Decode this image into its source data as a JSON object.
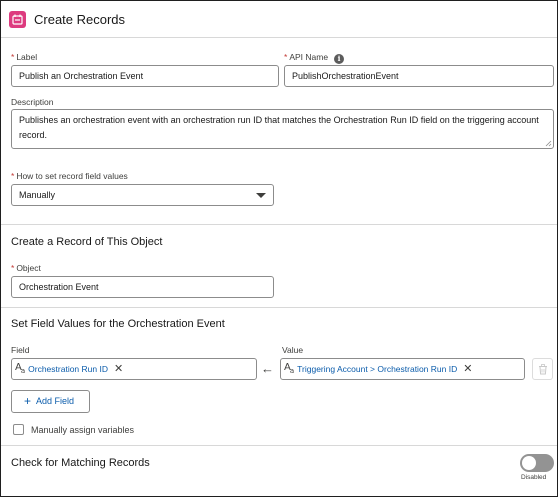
{
  "header": {
    "title": "Create Records",
    "icon": "create-records-icon",
    "icon_color": "#dd3b7f"
  },
  "label_field": {
    "label": "Label",
    "value": "Publish an Orchestration Event"
  },
  "api_name_field": {
    "label": "API Name",
    "value": "PublishOrchestrationEvent"
  },
  "description_field": {
    "label": "Description",
    "value": "Publishes an orchestration event with an orchestration run ID that matches the Orchestration Run ID field on the triggering account record."
  },
  "how_to_set": {
    "label": "How to set record field values",
    "value": "Manually"
  },
  "create_section": {
    "title": "Create a Record of This Object"
  },
  "object_field": {
    "label": "Object",
    "value": "Orchestration Event"
  },
  "field_values_section": {
    "title": "Set Field Values for the Orchestration Event",
    "field_label": "Field",
    "value_label": "Value",
    "rows": [
      {
        "field": "Orchestration Run ID",
        "value": "Triggering Account > Orchestration Run ID"
      }
    ],
    "add_button": "Add Field",
    "manual_assign": "Manually assign variables"
  },
  "matching_section": {
    "title": "Check for Matching Records",
    "toggle_state": "Disabled"
  },
  "colors": {
    "link": "#0b5cab",
    "required": "#c23934",
    "toggle_off": "#939393"
  }
}
